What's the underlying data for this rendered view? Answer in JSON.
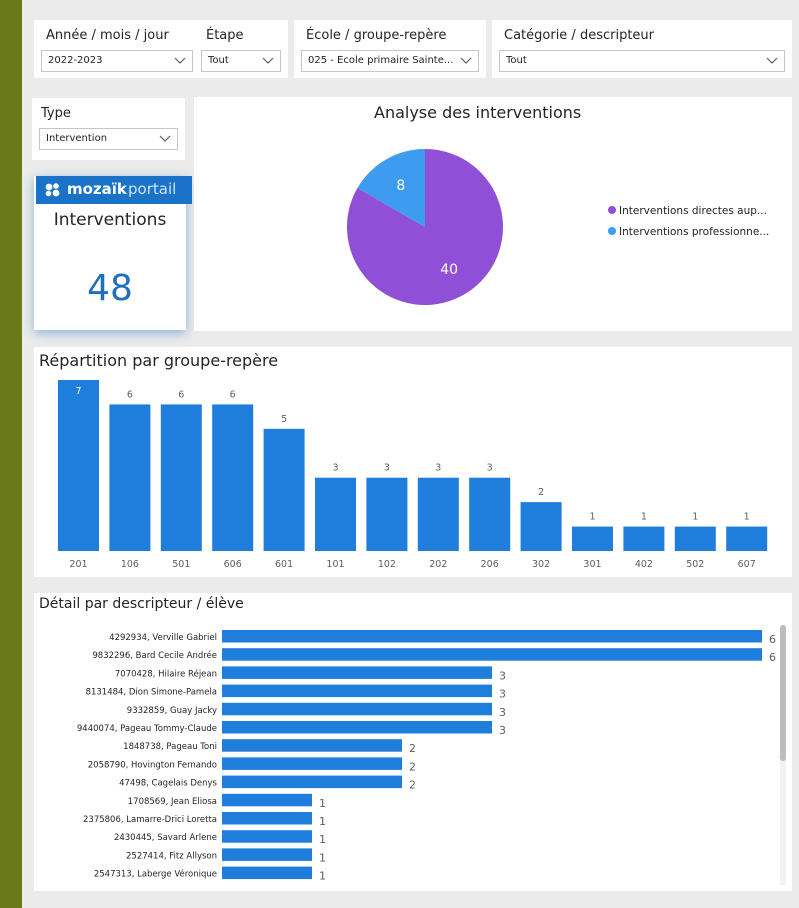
{
  "colors": {
    "frame_bg": "#6b7a19",
    "canvas_bg": "#ebebeb",
    "bar_blue": "#1f7ddb",
    "pie_purple": "#8f4fd6",
    "pie_blue": "#3d9cf0",
    "kpi_value": "#1f6fbf"
  },
  "filters": [
    {
      "label": "Année / mois / jour",
      "value": "2022-2023"
    },
    {
      "label": "Étape",
      "value": "Tout"
    },
    {
      "label": "École / groupe-repère",
      "value": "025 - École primaire Sainte..."
    },
    {
      "label": "Catégorie / descripteur",
      "value": "Tout"
    },
    {
      "label": "Type",
      "value": "Intervention"
    }
  ],
  "brand": {
    "name_bold": "mozaïk",
    "name_light": "portail"
  },
  "kpi": {
    "label": "Interventions",
    "value": "48"
  },
  "pie": {
    "title": "Analyse des interventions",
    "slices": [
      {
        "label": "Interventions directes aup...",
        "value": 40,
        "color": "#8f4fd6"
      },
      {
        "label": "Interventions professionne...",
        "value": 8,
        "color": "#3d9cf0"
      }
    ]
  },
  "bar_vertical": {
    "title": "Répartition par groupe-repère"
  },
  "bar_horizontal": {
    "title": "Détail par descripteur / élève"
  },
  "chart_data": [
    {
      "type": "pie",
      "title": "Analyse des interventions",
      "categories": [
        "Interventions directes aup...",
        "Interventions professionne..."
      ],
      "values": [
        40,
        8
      ]
    },
    {
      "type": "bar",
      "title": "Répartition par groupe-repère",
      "categories": [
        "201",
        "106",
        "501",
        "606",
        "601",
        "101",
        "102",
        "202",
        "206",
        "302",
        "301",
        "402",
        "502",
        "607"
      ],
      "values": [
        7,
        6,
        6,
        6,
        5,
        3,
        3,
        3,
        3,
        2,
        1,
        1,
        1,
        1
      ],
      "ylim": [
        0,
        7
      ]
    },
    {
      "type": "bar",
      "orientation": "horizontal",
      "title": "Détail par descripteur / élève",
      "categories": [
        "4292934, Verville Gabriel",
        "9832296, Bard Cecile Andrée",
        "7070428, Hilaire Réjean",
        "8131484, Dion Simone-Pamela",
        "9332859, Guay Jacky",
        "9440074, Pageau Tommy-Claude",
        "1848738, Pageau Toni",
        "2058790, Hovington Fernando",
        "47498, Cagelais Denys",
        "1708569, Jean Eliosa",
        "2375806, Lamarre-Drici Loretta",
        "2430445, Savard Arlene",
        "2527414, Fitz Allyson",
        "2547313, Laberge Véronique"
      ],
      "values": [
        6,
        6,
        3,
        3,
        3,
        3,
        2,
        2,
        2,
        1,
        1,
        1,
        1,
        1
      ],
      "xlim": [
        0,
        6
      ]
    }
  ]
}
